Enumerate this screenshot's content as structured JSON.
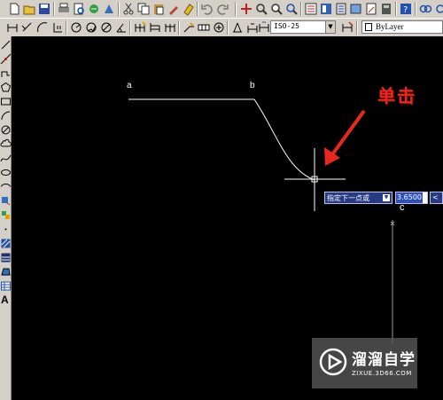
{
  "toolbar": {
    "dimstyle_combo": {
      "value": "ISO-25"
    },
    "layer_combo": {
      "value": "ByLayer"
    }
  },
  "left_toolbar": {
    "text_tool_label": "A"
  },
  "canvas": {
    "point_labels": {
      "a": "a",
      "b": "b",
      "c": "c"
    },
    "annotation": "单击",
    "dynamic_input": {
      "prompt": "指定下一点或",
      "coordinate_value": "3.6500",
      "angle_prefix": "<"
    }
  },
  "watermark": {
    "title": "溜溜自学",
    "url": "ZIXUE.3D66.COM"
  },
  "colors": {
    "background": "#000000",
    "toolbar": "#d4d0c8",
    "annotation": "#e8281e",
    "dynamic_prompt": "#273a86",
    "selection": "#2d4fbf"
  }
}
